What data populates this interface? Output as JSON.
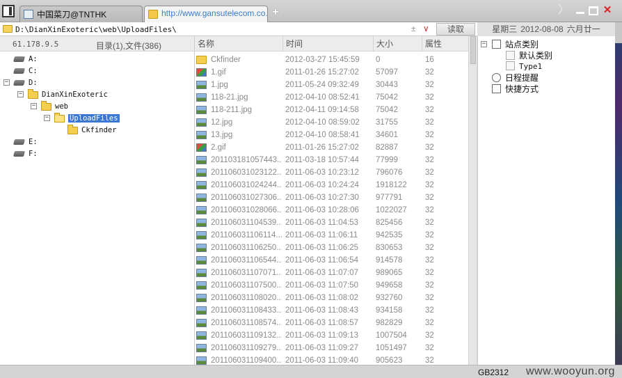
{
  "tabs": [
    {
      "label": "中国菜刀@TNTHK",
      "active": false
    },
    {
      "label": "http://www.gansutelecom.co...",
      "active": true
    }
  ],
  "new_tab_label": "+",
  "window": {
    "next_label": "〉",
    "close_label": "✕"
  },
  "address": {
    "path": "D:\\DianXinExoteric\\web\\UploadFiles\\",
    "plus_label": "±",
    "dropdown_label": "∨",
    "read_button": "读取"
  },
  "date": {
    "weekday": "星期三",
    "date": "2012-08-08",
    "lunar": "六月廿一"
  },
  "left": {
    "ip": "61.178.9.5",
    "summary": "目录(1),文件(386)",
    "tree": [
      {
        "label": "A:",
        "kind": "drive",
        "expander": ""
      },
      {
        "label": "C:",
        "kind": "drive",
        "expander": ""
      },
      {
        "label": "D:",
        "kind": "drive",
        "expander": "−"
      },
      {
        "label": "DianXinExoteric",
        "kind": "folder",
        "expander": "−"
      },
      {
        "label": "web",
        "kind": "folder",
        "expander": "−"
      },
      {
        "label": "UploadFiles",
        "kind": "folder",
        "expander": "−"
      },
      {
        "label": "Ckfinder",
        "kind": "folder",
        "expander": ""
      },
      {
        "label": "E:",
        "kind": "drive",
        "expander": ""
      },
      {
        "label": "F:",
        "kind": "drive",
        "expander": ""
      }
    ]
  },
  "list": {
    "headers": {
      "name": "名称",
      "time": "时间",
      "size": "大小",
      "attr": "属性"
    },
    "rows": [
      {
        "icon": "folder",
        "name": "Ckfinder",
        "time": "2012-03-27 15:45:59",
        "size": "0",
        "attr": "16"
      },
      {
        "icon": "gif",
        "name": "1.gif",
        "time": "2011-01-26 15:27:02",
        "size": "57097",
        "attr": "32"
      },
      {
        "icon": "img",
        "name": "1.jpg",
        "time": "2011-05-24 09:32:49",
        "size": "30443",
        "attr": "32"
      },
      {
        "icon": "img",
        "name": "118-21.jpg",
        "time": "2012-04-10 08:52:41",
        "size": "75042",
        "attr": "32"
      },
      {
        "icon": "img",
        "name": "118-211.jpg",
        "time": "2012-04-11 09:14:58",
        "size": "75042",
        "attr": "32"
      },
      {
        "icon": "img",
        "name": "12.jpg",
        "time": "2012-04-10 08:59:02",
        "size": "31755",
        "attr": "32"
      },
      {
        "icon": "img",
        "name": "13.jpg",
        "time": "2012-04-10 08:58:41",
        "size": "34601",
        "attr": "32"
      },
      {
        "icon": "gif",
        "name": "2.gif",
        "time": "2011-01-26 15:27:02",
        "size": "82887",
        "attr": "32"
      },
      {
        "icon": "img",
        "name": "201103181057443...",
        "time": "2011-03-18 10:57:44",
        "size": "77999",
        "attr": "32"
      },
      {
        "icon": "img",
        "name": "201106031023122...",
        "time": "2011-06-03 10:23:12",
        "size": "796076",
        "attr": "32"
      },
      {
        "icon": "img",
        "name": "201106031024244...",
        "time": "2011-06-03 10:24:24",
        "size": "1918122",
        "attr": "32"
      },
      {
        "icon": "img",
        "name": "201106031027306...",
        "time": "2011-06-03 10:27:30",
        "size": "977791",
        "attr": "32"
      },
      {
        "icon": "img",
        "name": "201106031028066...",
        "time": "2011-06-03 10:28:06",
        "size": "1022027",
        "attr": "32"
      },
      {
        "icon": "img",
        "name": "201106031104539...",
        "time": "2011-06-03 11:04:53",
        "size": "825456",
        "attr": "32"
      },
      {
        "icon": "img",
        "name": "201106031106114...",
        "time": "2011-06-03 11:06:11",
        "size": "942535",
        "attr": "32"
      },
      {
        "icon": "img",
        "name": "201106031106250...",
        "time": "2011-06-03 11:06:25",
        "size": "830653",
        "attr": "32"
      },
      {
        "icon": "img",
        "name": "201106031106544...",
        "time": "2011-06-03 11:06:54",
        "size": "914578",
        "attr": "32"
      },
      {
        "icon": "img",
        "name": "201106031107071...",
        "time": "2011-06-03 11:07:07",
        "size": "989065",
        "attr": "32"
      },
      {
        "icon": "img",
        "name": "201106031107500...",
        "time": "2011-06-03 11:07:50",
        "size": "949658",
        "attr": "32"
      },
      {
        "icon": "img",
        "name": "201106031108020...",
        "time": "2011-06-03 11:08:02",
        "size": "932760",
        "attr": "32"
      },
      {
        "icon": "img",
        "name": "201106031108433...",
        "time": "2011-06-03 11:08:43",
        "size": "934158",
        "attr": "32"
      },
      {
        "icon": "img",
        "name": "201106031108574...",
        "time": "2011-06-03 11:08:57",
        "size": "982829",
        "attr": "32"
      },
      {
        "icon": "img",
        "name": "201106031109132...",
        "time": "2011-06-03 11:09:13",
        "size": "1007504",
        "attr": "32"
      },
      {
        "icon": "img",
        "name": "201106031109279...",
        "time": "2011-06-03 11:09:27",
        "size": "1051497",
        "attr": "32"
      },
      {
        "icon": "img",
        "name": "201106031109400...",
        "time": "2011-06-03 11:09:40",
        "size": "905623",
        "attr": "32"
      }
    ]
  },
  "right": {
    "items": [
      {
        "label": "站点类别",
        "expander": "−"
      },
      {
        "label": "默认类别",
        "expander": ""
      },
      {
        "label": "Type1",
        "expander": ""
      },
      {
        "label": "日程提醒",
        "expander": ""
      },
      {
        "label": "快捷方式",
        "expander": ""
      }
    ]
  },
  "status": {
    "encoding": "GB2312",
    "watermark": "www.wooyun.org"
  },
  "colors": {
    "selection": "#3b78d4",
    "link": "#3a7fc8",
    "close": "#e02020"
  }
}
